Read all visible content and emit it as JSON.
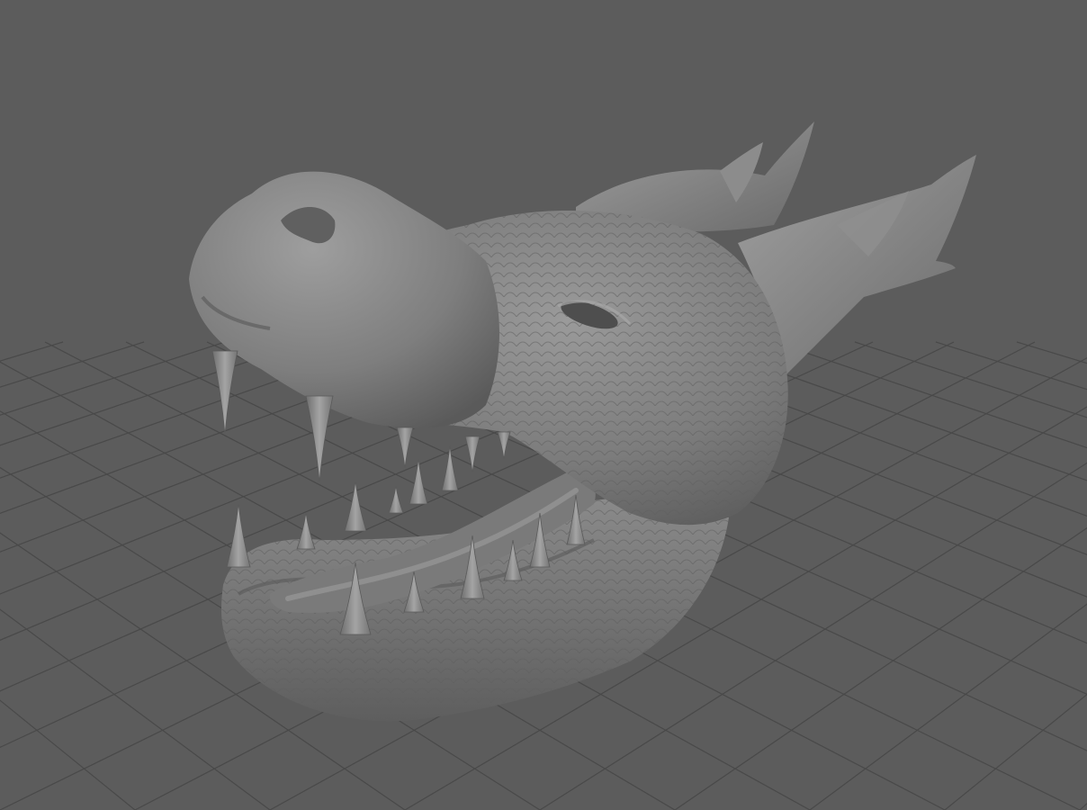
{
  "viewport": {
    "background_color": "#5c5c5c",
    "grid_color": "#494949",
    "mesh_color": "#8a8a8a",
    "grid_visible": true,
    "subject": "sculpted-dragon-head-mesh"
  }
}
